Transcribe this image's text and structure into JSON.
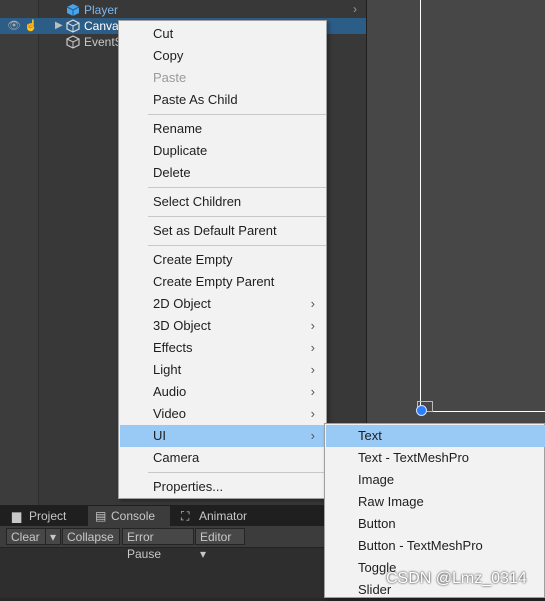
{
  "hierarchy": {
    "items": [
      {
        "label": "Player",
        "icon": "cube-icon",
        "state": "normal"
      },
      {
        "label": "Canvas",
        "icon": "cube-icon",
        "state": "selected"
      },
      {
        "label": "EventSystem",
        "icon": "cube-icon",
        "state": "normal"
      }
    ]
  },
  "context_menu": {
    "items": [
      {
        "label": "Cut"
      },
      {
        "label": "Copy"
      },
      {
        "label": "Paste",
        "disabled": true
      },
      {
        "label": "Paste As Child"
      },
      {
        "label": "Rename"
      },
      {
        "label": "Duplicate"
      },
      {
        "label": "Delete"
      },
      {
        "label": "Select Children"
      },
      {
        "label": "Set as Default Parent"
      },
      {
        "label": "Create Empty"
      },
      {
        "label": "Create Empty Parent"
      },
      {
        "label": "2D Object",
        "submenu": true
      },
      {
        "label": "3D Object",
        "submenu": true
      },
      {
        "label": "Effects",
        "submenu": true
      },
      {
        "label": "Light",
        "submenu": true
      },
      {
        "label": "Audio",
        "submenu": true
      },
      {
        "label": "Video",
        "submenu": true
      },
      {
        "label": "UI",
        "submenu": true,
        "highlighted": true
      },
      {
        "label": "Camera"
      },
      {
        "label": "Properties..."
      }
    ],
    "submenu_arrow": "›"
  },
  "ui_submenu": {
    "items": [
      {
        "label": "Text",
        "highlighted": true
      },
      {
        "label": "Text - TextMeshPro"
      },
      {
        "label": "Image"
      },
      {
        "label": "Raw Image"
      },
      {
        "label": "Button"
      },
      {
        "label": "Button - TextMeshPro"
      },
      {
        "label": "Toggle"
      },
      {
        "label": "Slider"
      }
    ]
  },
  "bottom_panel": {
    "tabs": [
      {
        "label": "Project",
        "icon": "folder-icon"
      },
      {
        "label": "Console",
        "icon": "console-icon",
        "active": true
      },
      {
        "label": "Animator",
        "icon": "animator-icon"
      }
    ],
    "toolbar": {
      "clear": "Clear",
      "collapse": "Collapse",
      "error_pause": "Error Pause",
      "editor": "Editor"
    }
  },
  "watermark": "CSDN @Lmz_0314",
  "colors": {
    "selection": "#2c5d87",
    "menu_highlight": "#99c9f5",
    "handle": "#2d7ff9"
  }
}
